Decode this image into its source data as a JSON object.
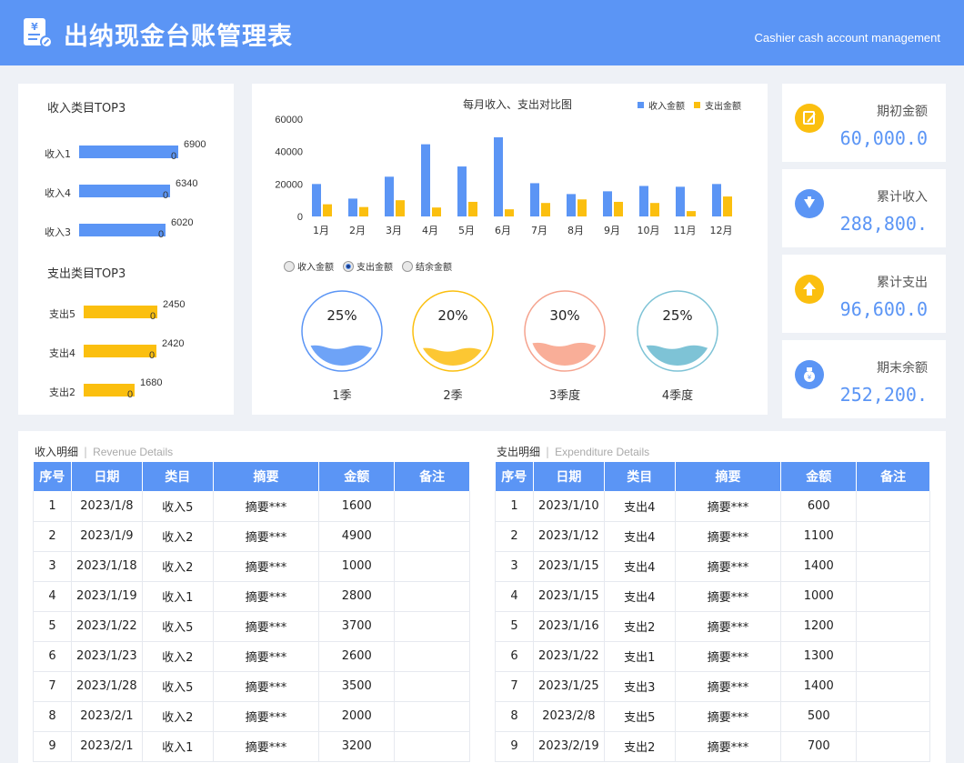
{
  "header": {
    "title": "出纳现金台账管理表",
    "subtitle": "Cashier cash account management"
  },
  "income_top3": {
    "title": "收入类目TOP3",
    "items": [
      {
        "label": "收入1",
        "value": "6900",
        "sub": "0",
        "amount": 6900
      },
      {
        "label": "收入4",
        "value": "6340",
        "sub": "0",
        "amount": 6340
      },
      {
        "label": "收入3",
        "value": "6020",
        "sub": "0",
        "amount": 6020
      }
    ]
  },
  "expense_top3": {
    "title": "支出类目TOP3",
    "items": [
      {
        "label": "支出5",
        "value": "2450",
        "sub": "0",
        "amount": 2450
      },
      {
        "label": "支出4",
        "value": "2420",
        "sub": "0",
        "amount": 2420
      },
      {
        "label": "支出2",
        "value": "1680",
        "sub": "0",
        "amount": 1680
      }
    ]
  },
  "colors": {
    "income": "#5b95f5",
    "expense": "#fbbf0f",
    "header": "#5b95f5"
  },
  "chart_data": {
    "type": "bar",
    "title": "每月收入、支出对比图",
    "categories": [
      "1月",
      "2月",
      "3月",
      "4月",
      "5月",
      "6月",
      "7月",
      "8月",
      "9月",
      "10月",
      "11月",
      "12月"
    ],
    "series": [
      {
        "name": "收入金额",
        "values": [
          20000,
          11000,
          24500,
          44500,
          30800,
          48800,
          20500,
          13800,
          15500,
          18800,
          18300,
          20000
        ]
      },
      {
        "name": "支出金额",
        "values": [
          7500,
          5800,
          10000,
          5500,
          9000,
          4400,
          8300,
          10500,
          9000,
          8300,
          3300,
          12300
        ]
      }
    ],
    "yticks": [
      "0",
      "20000",
      "40000",
      "60000"
    ],
    "ylim": [
      0,
      60000
    ],
    "legend": "top-right",
    "grid": false
  },
  "radios": [
    {
      "label": "收入金额",
      "checked": false
    },
    {
      "label": "支出金额",
      "checked": true
    },
    {
      "label": "结余金额",
      "checked": false
    }
  ],
  "quarters": [
    {
      "label": "1季",
      "percent": "25%",
      "fraction": 0.25,
      "color": "#5b95f5",
      "fill": "#6ea3f7"
    },
    {
      "label": "2季",
      "percent": "20%",
      "fraction": 0.2,
      "color": "#fbbf0f",
      "fill": "#fcc733"
    },
    {
      "label": "3季度",
      "percent": "30%",
      "fraction": 0.3,
      "color": "#f5a38e",
      "fill": "#f9ae98"
    },
    {
      "label": "4季度",
      "percent": "25%",
      "fraction": 0.25,
      "color": "#7ec3d6",
      "fill": "#7ec3d6"
    }
  ],
  "stats": [
    {
      "label": "期初金额",
      "value": "60,000.0",
      "icon": "edit-icon"
    },
    {
      "label": "累计收入",
      "value": "288,800.",
      "icon": "download-icon"
    },
    {
      "label": "累计支出",
      "value": "96,600.0",
      "icon": "upload-icon"
    },
    {
      "label": "期末余额",
      "value": "252,200.",
      "icon": "money-bag-icon"
    }
  ],
  "revenue_table": {
    "title": "收入明细",
    "title_en": "Revenue Details",
    "headers": [
      "序号",
      "日期",
      "类目",
      "摘要",
      "金额",
      "备注"
    ],
    "rows": [
      [
        "1",
        "2023/1/8",
        "收入5",
        "摘要***",
        "1600",
        ""
      ],
      [
        "2",
        "2023/1/9",
        "收入2",
        "摘要***",
        "4900",
        ""
      ],
      [
        "3",
        "2023/1/18",
        "收入2",
        "摘要***",
        "1000",
        ""
      ],
      [
        "4",
        "2023/1/19",
        "收入1",
        "摘要***",
        "2800",
        ""
      ],
      [
        "5",
        "2023/1/22",
        "收入5",
        "摘要***",
        "3700",
        ""
      ],
      [
        "6",
        "2023/1/23",
        "收入2",
        "摘要***",
        "2600",
        ""
      ],
      [
        "7",
        "2023/1/28",
        "收入5",
        "摘要***",
        "3500",
        ""
      ],
      [
        "8",
        "2023/2/1",
        "收入2",
        "摘要***",
        "2000",
        ""
      ],
      [
        "9",
        "2023/2/1",
        "收入1",
        "摘要***",
        "3200",
        ""
      ]
    ]
  },
  "expense_table": {
    "title": "支出明细",
    "title_en": "Expenditure Details",
    "headers": [
      "序号",
      "日期",
      "类目",
      "摘要",
      "金额",
      "备注"
    ],
    "rows": [
      [
        "1",
        "2023/1/10",
        "支出4",
        "摘要***",
        "600",
        ""
      ],
      [
        "2",
        "2023/1/12",
        "支出4",
        "摘要***",
        "1100",
        ""
      ],
      [
        "3",
        "2023/1/15",
        "支出4",
        "摘要***",
        "1400",
        ""
      ],
      [
        "4",
        "2023/1/15",
        "支出4",
        "摘要***",
        "1000",
        ""
      ],
      [
        "5",
        "2023/1/16",
        "支出2",
        "摘要***",
        "1200",
        ""
      ],
      [
        "6",
        "2023/1/22",
        "支出1",
        "摘要***",
        "1300",
        ""
      ],
      [
        "7",
        "2023/1/25",
        "支出3",
        "摘要***",
        "1400",
        ""
      ],
      [
        "8",
        "2023/2/8",
        "支出5",
        "摘要***",
        "500",
        ""
      ],
      [
        "9",
        "2023/2/19",
        "支出2",
        "摘要***",
        "700",
        ""
      ]
    ]
  }
}
